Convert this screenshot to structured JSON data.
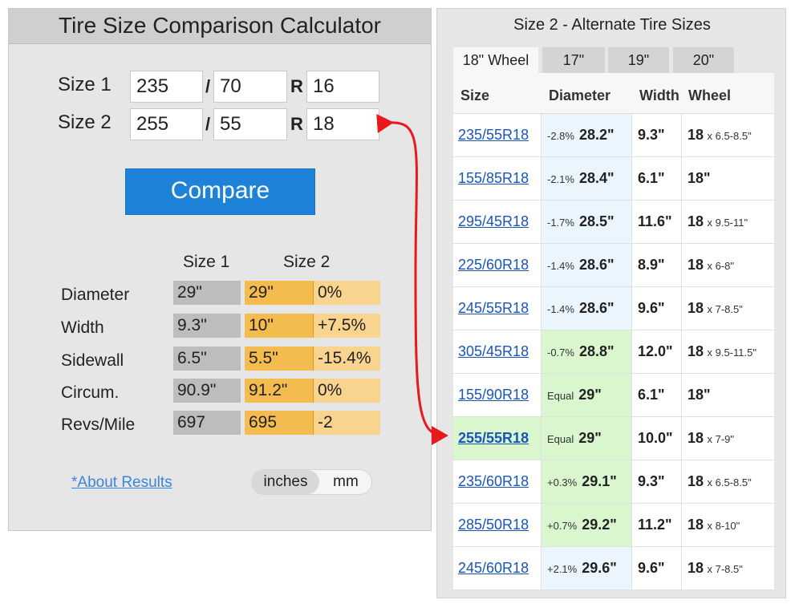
{
  "calculator": {
    "title": "Tire Size Comparison Calculator",
    "size1": {
      "label": "Size 1",
      "width": "235",
      "aspect": "70",
      "rim": "16"
    },
    "size2": {
      "label": "Size 2",
      "width": "255",
      "aspect": "55",
      "rim": "18"
    },
    "slash": "/",
    "r_sep": "R",
    "compare_label": "Compare",
    "results": {
      "col_size1": "Size 1",
      "col_size2": "Size 2",
      "rows": [
        {
          "label": "Diameter",
          "s1": "29\"",
          "s2": "29\"",
          "diff": "0%"
        },
        {
          "label": "Width",
          "s1": "9.3\"",
          "s2": "10\"",
          "diff": "+7.5%"
        },
        {
          "label": "Sidewall",
          "s1": "6.5\"",
          "s2": "5.5\"",
          "diff": "-15.4%"
        },
        {
          "label": "Circum.",
          "s1": "90.9\"",
          "s2": "91.2\"",
          "diff": "0%"
        },
        {
          "label": "Revs/Mile",
          "s1": "697",
          "s2": "695",
          "diff": "-2"
        }
      ]
    },
    "about_link": "*About Results",
    "units": {
      "inches": "inches",
      "mm": "mm",
      "selected": "inches"
    }
  },
  "alternates": {
    "title": "Size 2 - Alternate Tire Sizes",
    "tabs": [
      "18\" Wheel",
      "17\"",
      "19\"",
      "20\""
    ],
    "active_tab": "18\" Wheel",
    "headers": {
      "size": "Size",
      "diameter": "Diameter",
      "width": "Width",
      "wheel": "Wheel"
    },
    "rows": [
      {
        "size": "235/55R18",
        "diff": "-2.8%",
        "diam": "28.2\"",
        "width": "9.3\"",
        "wheel": "18",
        "range": "x 6.5-8.5\""
      },
      {
        "size": "155/85R18",
        "diff": "-2.1%",
        "diam": "28.4\"",
        "width": "6.1\"",
        "wheel": "18\"",
        "range": ""
      },
      {
        "size": "295/45R18",
        "diff": "-1.7%",
        "diam": "28.5\"",
        "width": "11.6\"",
        "wheel": "18",
        "range": "x 9.5-11\""
      },
      {
        "size": "225/60R18",
        "diff": "-1.4%",
        "diam": "28.6\"",
        "width": "8.9\"",
        "wheel": "18",
        "range": "x 6-8\""
      },
      {
        "size": "245/55R18",
        "diff": "-1.4%",
        "diam": "28.6\"",
        "width": "9.6\"",
        "wheel": "18",
        "range": "x 7-8.5\""
      },
      {
        "size": "305/45R18",
        "diff": "-0.7%",
        "diam": "28.8\"",
        "width": "12.0\"",
        "wheel": "18",
        "range": "x 9.5-11.5\""
      },
      {
        "size": "155/90R18",
        "diff": "Equal",
        "diam": "29\"",
        "width": "6.1\"",
        "wheel": "18\"",
        "range": ""
      },
      {
        "size": "255/55R18",
        "diff": "Equal",
        "diam": "29\"",
        "width": "10.0\"",
        "wheel": "18",
        "range": "x 7-9\""
      },
      {
        "size": "235/60R18",
        "diff": "+0.3%",
        "diam": "29.1\"",
        "width": "9.3\"",
        "wheel": "18",
        "range": "x 6.5-8.5\""
      },
      {
        "size": "285/50R18",
        "diff": "+0.7%",
        "diam": "29.2\"",
        "width": "11.2\"",
        "wheel": "18",
        "range": "x 8-10\""
      },
      {
        "size": "245/60R18",
        "diff": "+2.1%",
        "diam": "29.6\"",
        "width": "9.6\"",
        "wheel": "18",
        "range": "x 7-8.5\""
      }
    ],
    "selected_size": "255/55R18",
    "colors": {
      "arrow": "#e8191c",
      "link": "#1a55b8",
      "compare_button": "#1e82d8"
    }
  }
}
